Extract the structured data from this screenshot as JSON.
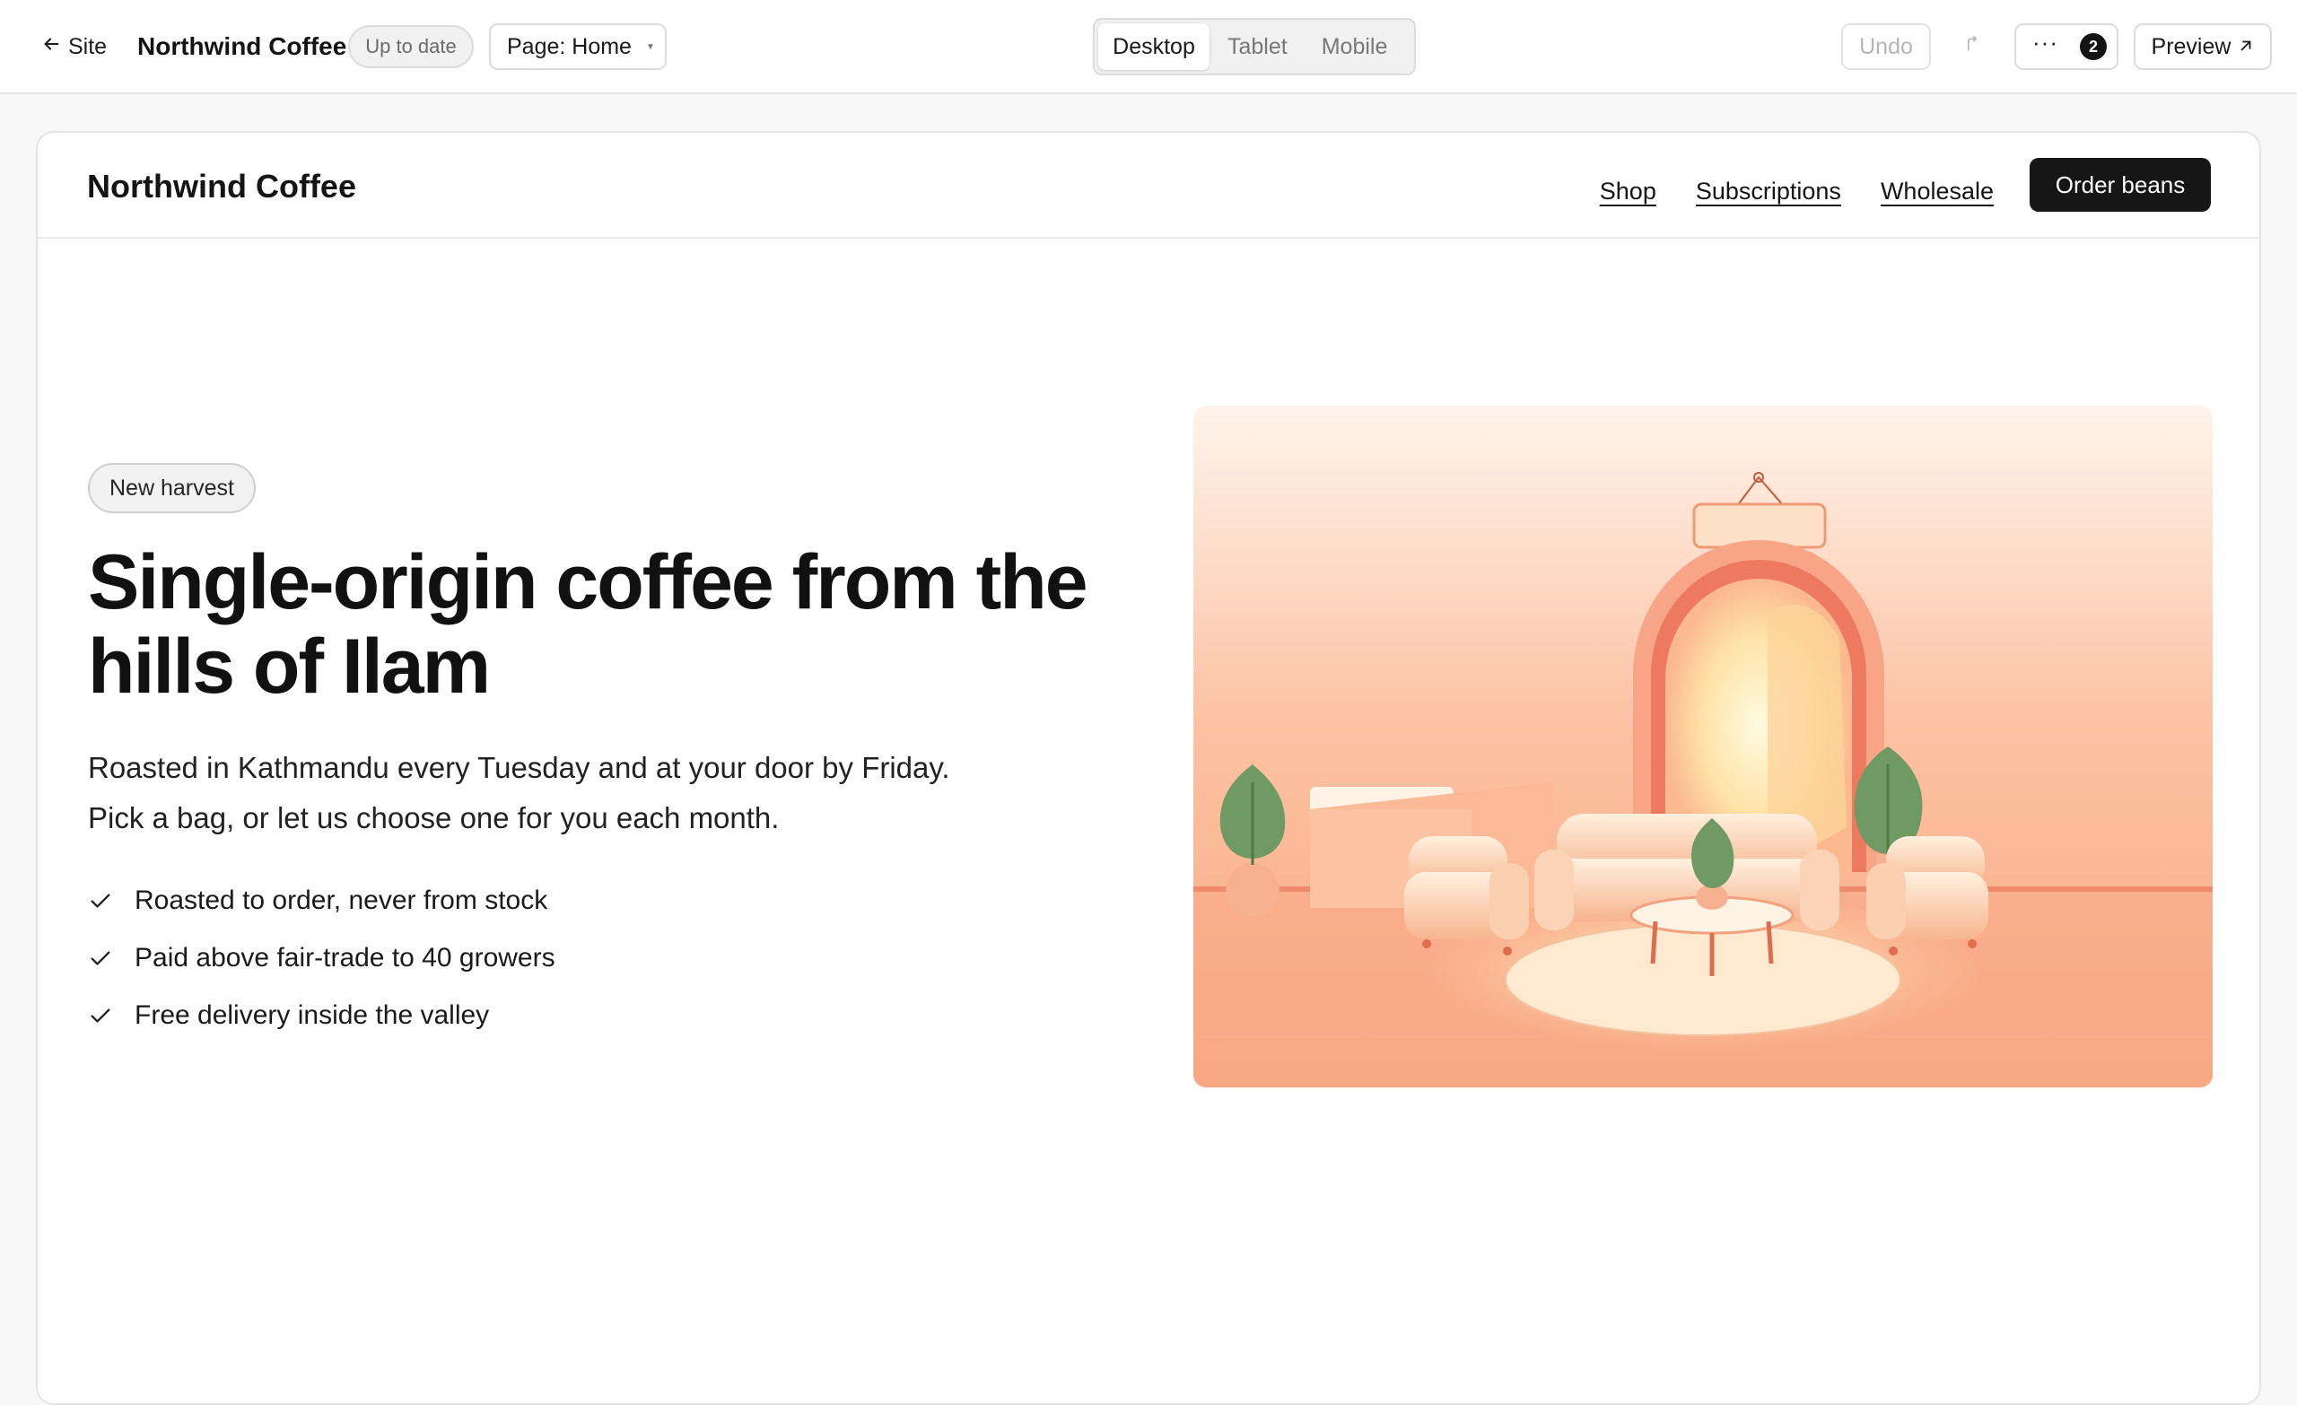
{
  "editor": {
    "back_label": "Site",
    "site_name": "Northwind Coffee",
    "status": "Up to date",
    "page_select": "Page: Home",
    "devices": [
      "Desktop",
      "Tablet",
      "Mobile"
    ],
    "active_device": "Desktop",
    "undo_label": "Undo",
    "more_count": "2",
    "preview_label": "Preview"
  },
  "site": {
    "logo": "Northwind Coffee",
    "nav": [
      "Shop",
      "Subscriptions",
      "Wholesale"
    ],
    "cta": "Order beans"
  },
  "hero": {
    "badge": "New harvest",
    "title": "Single-origin coffee from the hills of Ilam",
    "subtitle": "Roasted in Kathmandu every Tuesday and at your door by Friday. Pick a bag, or let us choose one for you each month.",
    "features": [
      "Roasted to order, never from stock",
      "Paid above fair-trade to 40 growers",
      "Free delivery inside the valley"
    ],
    "image_icon": "lounge-illustration"
  },
  "colors": {
    "primary": "#161616",
    "accent_peach": "#f9a785",
    "accent_coral": "#ef7a5f",
    "plant_green": "#6f9a63"
  }
}
